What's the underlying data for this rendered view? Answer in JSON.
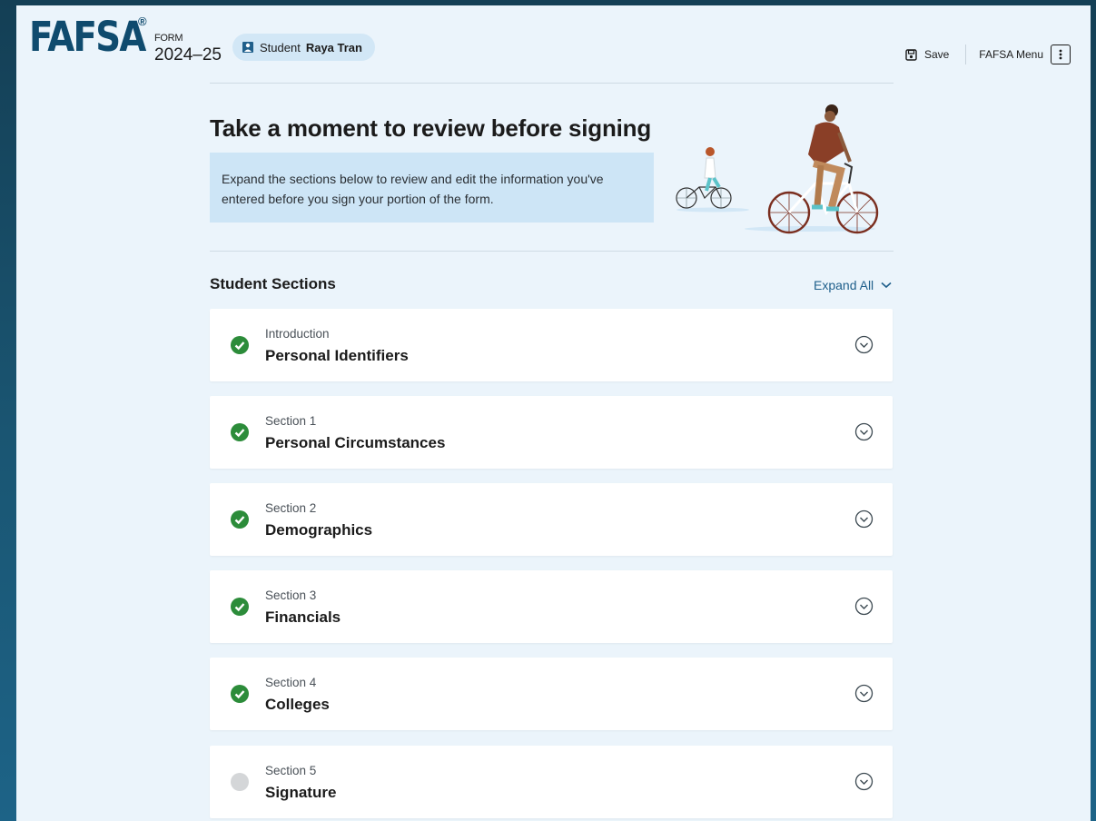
{
  "header": {
    "logo": "FAFSA",
    "registered": "®",
    "form_label": "FORM",
    "form_year": "2024–25",
    "student_prefix": "Student",
    "student_name": "Raya Tran",
    "save_label": "Save",
    "menu_label": "FAFSA Menu"
  },
  "intro": {
    "title": "Take a moment to review before signing",
    "description": "Expand the sections below to review and edit the information you've entered before you sign your portion of the form."
  },
  "sections": {
    "heading": "Student Sections",
    "expand_all": "Expand All",
    "items": [
      {
        "sub": "Introduction",
        "name": "Personal Identifiers",
        "complete": true
      },
      {
        "sub": "Section 1",
        "name": "Personal Circumstances",
        "complete": true
      },
      {
        "sub": "Section 2",
        "name": "Demographics",
        "complete": true
      },
      {
        "sub": "Section 3",
        "name": "Financials",
        "complete": true
      },
      {
        "sub": "Section 4",
        "name": "Colleges",
        "complete": true
      },
      {
        "sub": "Section 5",
        "name": "Signature",
        "complete": false
      }
    ]
  },
  "colors": {
    "brand": "#0f4b6e",
    "complete": "#2c8c3a",
    "incomplete": "#d4d6d8",
    "link": "#1f5f8b"
  }
}
